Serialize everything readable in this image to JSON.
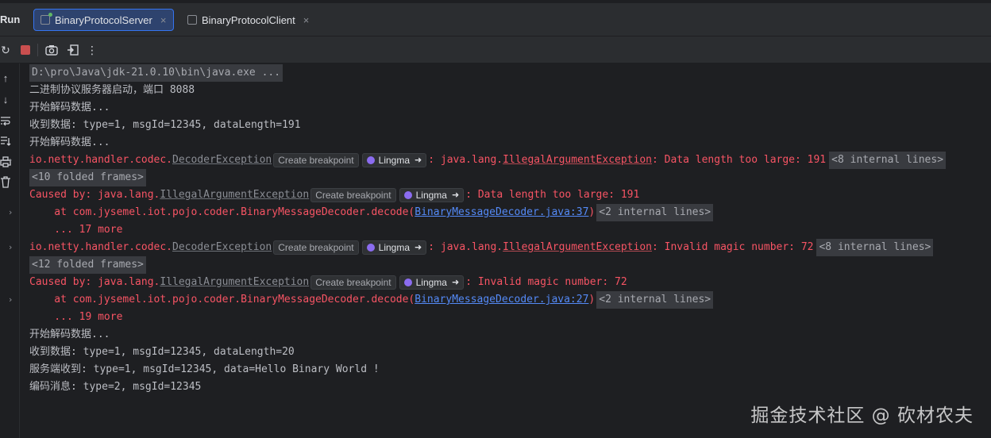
{
  "header": {
    "run_title": "Run",
    "tabs": [
      {
        "label": "BinaryProtocolServer",
        "close": "×"
      },
      {
        "label": "BinaryProtocolClient",
        "close": "×"
      }
    ]
  },
  "toolbar": {
    "rerun_icon": "↻",
    "camera_icon": "📷",
    "exit_icon": "⇥",
    "more_icon": "⋮"
  },
  "sidebar_icons": {
    "up": "↑",
    "down": "↓",
    "wrap": "⤶",
    "scroll_end": "⇊",
    "print": "⎙",
    "trash": "🗑"
  },
  "chips": {
    "breakpoint": "Create breakpoint",
    "ai": "Lingma",
    "ai_arrow": "➜"
  },
  "console": {
    "cmd": "D:\\pro\\Java\\jdk-21.0.10\\bin\\java.exe ...",
    "l1": "二进制协议服务器启动，端口 8088",
    "l2": "开始解码数据...",
    "l3": "收到数据: type=1, msgId=12345, dataLength=191",
    "l4": "开始解码数据...",
    "e1_pkg": "io.netty.handler.codec.",
    "e1_cls": "DecoderException",
    "e1_msg_pre": ": java.lang.",
    "e1_msg_cls": "IllegalArgumentException",
    "e1_msg_post": ": Data length too large: 191",
    "e1_fold": "<8 internal lines>",
    "fold1": "<10 folded frames>",
    "c1_pre": "Caused by: java.lang.",
    "c1_cls": "IllegalArgumentException",
    "c1_post": ": Data length too large: 191",
    "at1_pre": "    at com.jysemel.iot.pojo.coder.BinaryMessageDecoder.decode(",
    "at1_link": "BinaryMessageDecoder.java:37",
    "at1_post": ")",
    "at1_fold": "<2 internal lines>",
    "more1": "    ... 17 more",
    "e2_pkg": "io.netty.handler.codec.",
    "e2_cls": "DecoderException",
    "e2_msg_pre": ": java.lang.",
    "e2_msg_cls": "IllegalArgumentException",
    "e2_msg_post": ": Invalid magic number: 72",
    "e2_fold": "<8 internal lines>",
    "fold2": "<12 folded frames>",
    "c2_pre": "Caused by: java.lang.",
    "c2_cls": "IllegalArgumentException",
    "c2_post": ": Invalid magic number: 72",
    "at2_pre": "    at com.jysemel.iot.pojo.coder.BinaryMessageDecoder.decode(",
    "at2_link": "BinaryMessageDecoder.java:27",
    "at2_post": ")",
    "at2_fold": "<2 internal lines>",
    "more2": "    ... 19 more",
    "l5": "开始解码数据...",
    "l6": "收到数据: type=1, msgId=12345, dataLength=20",
    "l7": "服务端收到: type=1, msgId=12345, data=Hello Binary World !",
    "l8": "编码消息: type=2, msgId=12345"
  },
  "watermark": "掘金技术社区 @ 砍材农夫",
  "colors": {
    "background": "#1e1f22",
    "panel": "#2b2d30",
    "error": "#f75464",
    "link": "#548af7",
    "active_tab": "#2e436e",
    "stop": "#c94f4f"
  }
}
